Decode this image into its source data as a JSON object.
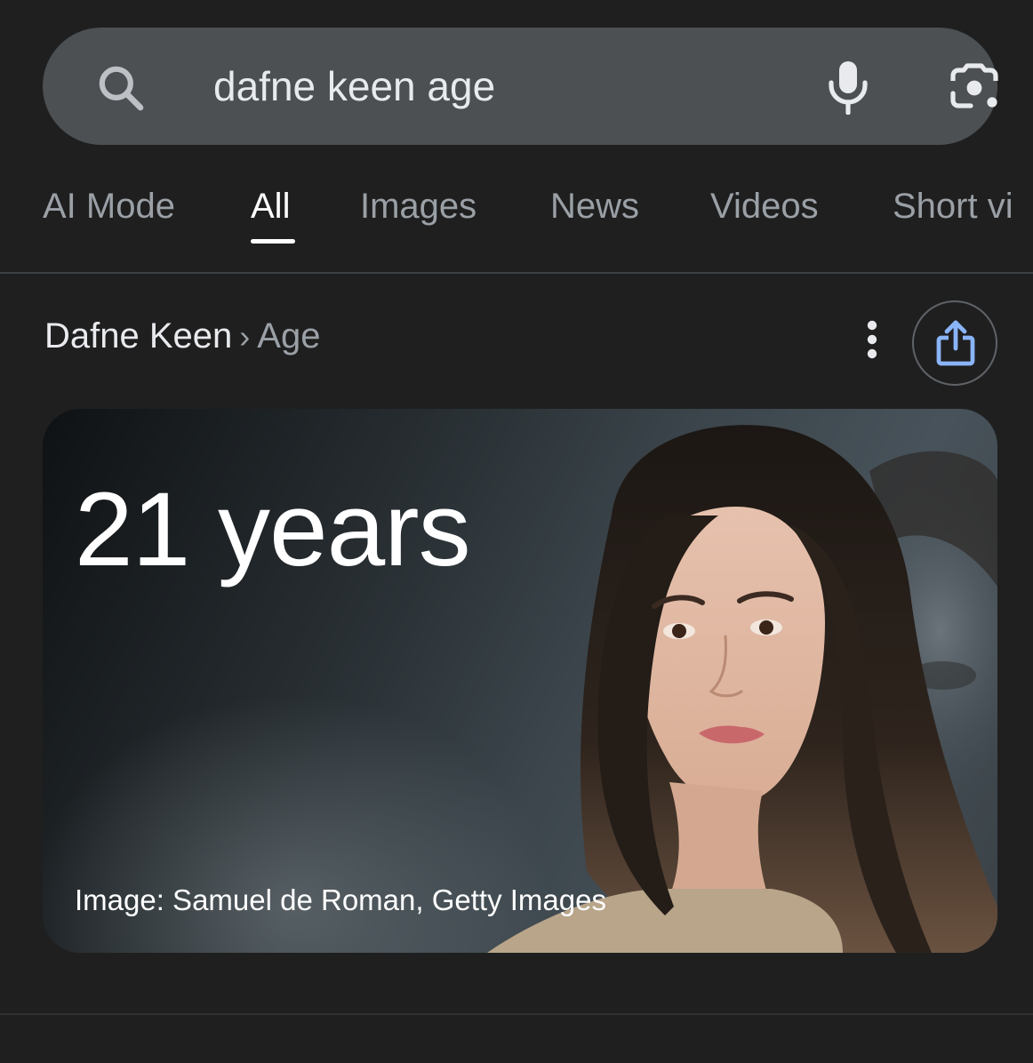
{
  "search": {
    "query": "dafne keen age"
  },
  "tabs": [
    {
      "label": "AI Mode"
    },
    {
      "label": "All"
    },
    {
      "label": "Images"
    },
    {
      "label": "News"
    },
    {
      "label": "Videos"
    },
    {
      "label": "Short vi"
    }
  ],
  "active_tab": "All",
  "breadcrumb": {
    "entity": "Dafne Keen",
    "separator": "›",
    "attribute": "Age"
  },
  "answer": {
    "value": "21 years",
    "image_credit": "Image: Samuel de Roman, Getty Images"
  },
  "icons": {
    "search": "search-icon",
    "mic": "microphone-icon",
    "lens": "google-lens-icon",
    "more": "more-vertical-icon",
    "share": "share-icon"
  },
  "colors": {
    "background": "#1f1f1f",
    "search_bar": "#4c5053",
    "share_accent": "#8ab4f8",
    "tab_inactive": "#9aa0a6",
    "tab_active": "#ffffff"
  }
}
